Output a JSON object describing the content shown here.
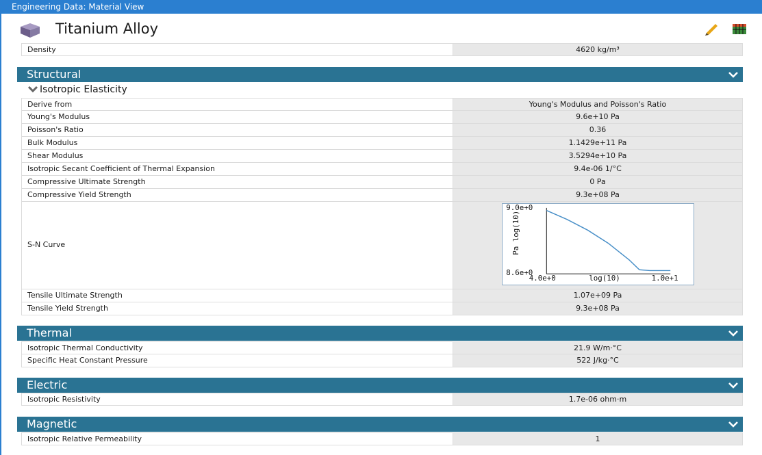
{
  "window": {
    "title": "Engineering Data: Material View"
  },
  "material": {
    "name": "Titanium Alloy",
    "icons": [
      "cube-icon",
      "pencil-icon",
      "grid-icon"
    ]
  },
  "colors": {
    "titlebar": "#2b7fd0",
    "section_header": "#2a7393",
    "value_cell": "#e8e8e8",
    "curve": "#4a90c8"
  },
  "general": [
    {
      "label": "Density",
      "value": "4620 kg/m³"
    }
  ],
  "structural": {
    "title": "Structural",
    "subsection": "Isotropic Elasticity",
    "rows": [
      {
        "label": "Derive from",
        "value": "Young's Modulus and Poisson's Ratio"
      },
      {
        "label": "Young's Modulus",
        "value": "9.6e+10  Pa"
      },
      {
        "label": "Poisson's Ratio",
        "value": "0.36"
      },
      {
        "label": "Bulk Modulus",
        "value": "1.1429e+11  Pa"
      },
      {
        "label": "Shear Modulus",
        "value": "3.5294e+10  Pa"
      },
      {
        "label": "Isotropic Secant Coefficient of Thermal Expansion",
        "value": "9.4e-06  1/°C"
      },
      {
        "label": "Compressive Ultimate Strength",
        "value": "0  Pa"
      },
      {
        "label": "Compressive Yield Strength",
        "value": "9.3e+08  Pa"
      }
    ],
    "sn_curve_label": "S-N Curve",
    "rows_after": [
      {
        "label": "Tensile Ultimate Strength",
        "value": "1.07e+09  Pa"
      },
      {
        "label": "Tensile Yield Strength",
        "value": "9.3e+08  Pa"
      }
    ]
  },
  "chart_data": {
    "type": "line",
    "title": "",
    "xlabel": "log(10)",
    "ylabel": "Pa log(10)",
    "x_tick_labels": [
      "4.0e+0",
      "1.0e+1"
    ],
    "y_tick_labels": [
      "9.0e+0",
      "8.6e+0"
    ],
    "xlim": [
      4.0,
      10.0
    ],
    "ylim": [
      8.6,
      9.0
    ],
    "grid": false,
    "series": [
      {
        "x": [
          4.0,
          5.0,
          6.0,
          7.0,
          8.0,
          8.5,
          9.0,
          10.0
        ],
        "y": [
          8.985,
          8.93,
          8.865,
          8.785,
          8.685,
          8.625,
          8.62,
          8.62
        ]
      }
    ]
  },
  "thermal": {
    "title": "Thermal",
    "rows": [
      {
        "label": "Isotropic Thermal Conductivity",
        "value": "21.9  W/m·°C"
      },
      {
        "label": "Specific Heat Constant Pressure",
        "value": "522  J/kg·°C"
      }
    ]
  },
  "electric": {
    "title": "Electric",
    "rows": [
      {
        "label": "Isotropic Resistivity",
        "value": "1.7e-06  ohm·m"
      }
    ]
  },
  "magnetic": {
    "title": "Magnetic",
    "rows": [
      {
        "label": "Isotropic Relative Permeability",
        "value": "1"
      }
    ]
  }
}
